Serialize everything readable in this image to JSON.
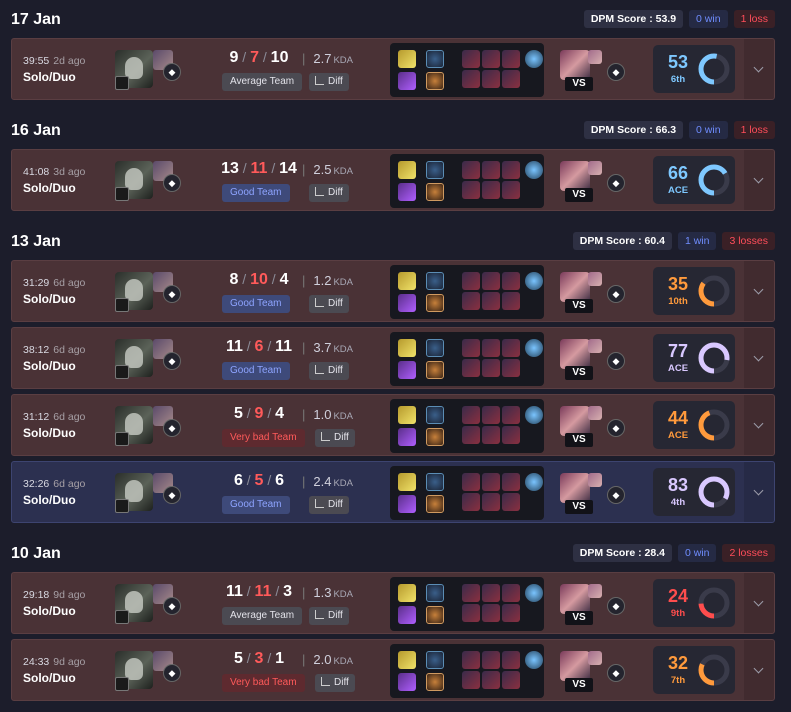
{
  "days": [
    {
      "date": "17 Jan",
      "dpm_score": "DPM Score : 53.9",
      "wins": "0 win",
      "losses": "1 loss",
      "matches": [
        {
          "duration": "39:55",
          "ago": "2d ago",
          "queue": "Solo/Duo",
          "kills": "9",
          "deaths": "7",
          "assists": "10",
          "kda": "2.7",
          "kda_label": "KDA",
          "team": "Average Team",
          "team_kind": "avg",
          "diff": "Diff",
          "vs": "VS",
          "score": "53",
          "rank": "6th",
          "score_color": "#7ec8ff",
          "score_pct": 0.53,
          "result": "loss"
        }
      ]
    },
    {
      "date": "16 Jan",
      "dpm_score": "DPM Score : 66.3",
      "wins": "0 win",
      "losses": "1 loss",
      "matches": [
        {
          "duration": "41:08",
          "ago": "3d ago",
          "queue": "Solo/Duo",
          "kills": "13",
          "deaths": "11",
          "assists": "14",
          "kda": "2.5",
          "kda_label": "KDA",
          "team": "Good Team",
          "team_kind": "good",
          "diff": "Diff",
          "vs": "VS",
          "score": "66",
          "rank": "ACE",
          "score_color": "#7ec8ff",
          "score_pct": 0.66,
          "result": "loss"
        }
      ]
    },
    {
      "date": "13 Jan",
      "dpm_score": "DPM Score : 60.4",
      "wins": "1 win",
      "losses": "3 losses",
      "matches": [
        {
          "duration": "31:29",
          "ago": "6d ago",
          "queue": "Solo/Duo",
          "kills": "8",
          "deaths": "10",
          "assists": "4",
          "kda": "1.2",
          "kda_label": "KDA",
          "team": "Good Team",
          "team_kind": "good",
          "diff": "Diff",
          "vs": "VS",
          "score": "35",
          "rank": "10th",
          "score_color": "#ff9a3c",
          "score_pct": 0.35,
          "result": "loss"
        },
        {
          "duration": "38:12",
          "ago": "6d ago",
          "queue": "Solo/Duo",
          "kills": "11",
          "deaths": "6",
          "assists": "11",
          "kda": "3.7",
          "kda_label": "KDA",
          "team": "Good Team",
          "team_kind": "good",
          "diff": "Diff",
          "vs": "VS",
          "score": "77",
          "rank": "ACE",
          "score_color": "#d9c8ff",
          "score_pct": 0.77,
          "result": "loss"
        },
        {
          "duration": "31:12",
          "ago": "6d ago",
          "queue": "Solo/Duo",
          "kills": "5",
          "deaths": "9",
          "assists": "4",
          "kda": "1.0",
          "kda_label": "KDA",
          "team": "Very bad Team",
          "team_kind": "bad",
          "diff": "Diff",
          "vs": "VS",
          "score": "44",
          "rank": "ACE",
          "score_color": "#ff9a3c",
          "score_pct": 0.44,
          "result": "loss"
        },
        {
          "duration": "32:26",
          "ago": "6d ago",
          "queue": "Solo/Duo",
          "kills": "6",
          "deaths": "5",
          "assists": "6",
          "kda": "2.4",
          "kda_label": "KDA",
          "team": "Good Team",
          "team_kind": "good",
          "diff": "Diff",
          "vs": "VS",
          "score": "83",
          "rank": "4th",
          "score_color": "#d9c8ff",
          "score_pct": 0.83,
          "result": "win"
        }
      ]
    },
    {
      "date": "10 Jan",
      "dpm_score": "DPM Score : 28.4",
      "wins": "0 win",
      "losses": "2 losses",
      "matches": [
        {
          "duration": "29:18",
          "ago": "9d ago",
          "queue": "Solo/Duo",
          "kills": "11",
          "deaths": "11",
          "assists": "3",
          "kda": "1.3",
          "kda_label": "KDA",
          "team": "Average Team",
          "team_kind": "avg",
          "diff": "Diff",
          "vs": "VS",
          "score": "24",
          "rank": "9th",
          "score_color": "#ff4d4d",
          "score_pct": 0.24,
          "result": "loss"
        },
        {
          "duration": "24:33",
          "ago": "9d ago",
          "queue": "Solo/Duo",
          "kills": "5",
          "deaths": "3",
          "assists": "1",
          "kda": "2.0",
          "kda_label": "KDA",
          "team": "Very bad Team",
          "team_kind": "bad",
          "diff": "Diff",
          "vs": "VS",
          "score": "32",
          "rank": "7th",
          "score_color": "#ff9a3c",
          "score_pct": 0.32,
          "result": "loss"
        }
      ]
    }
  ],
  "icons": {
    "expand": "chevron-down-icon",
    "rank": "rank-emblem-icon",
    "diff": "lane-diff-icon",
    "ward": "ward-icon"
  }
}
